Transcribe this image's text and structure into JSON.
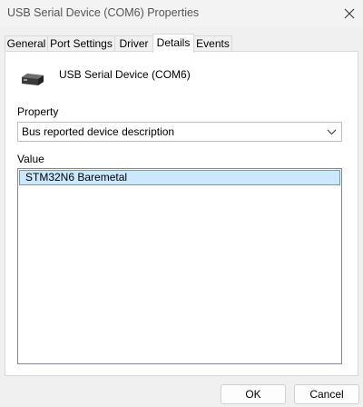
{
  "window": {
    "title": "USB Serial Device (COM6) Properties",
    "close_icon": "close-icon"
  },
  "tabs": [
    {
      "label": "General",
      "active": false
    },
    {
      "label": "Port Settings",
      "active": false
    },
    {
      "label": "Driver",
      "active": false
    },
    {
      "label": "Details",
      "active": true
    },
    {
      "label": "Events",
      "active": false
    }
  ],
  "details": {
    "device_icon": "usb-device-icon",
    "device_name": "USB Serial Device (COM6)",
    "property_label": "Property",
    "property_value": "Bus reported device description",
    "value_label": "Value",
    "values": [
      "STM32N6 Baremetal"
    ]
  },
  "buttons": {
    "ok": "OK",
    "cancel": "Cancel"
  }
}
